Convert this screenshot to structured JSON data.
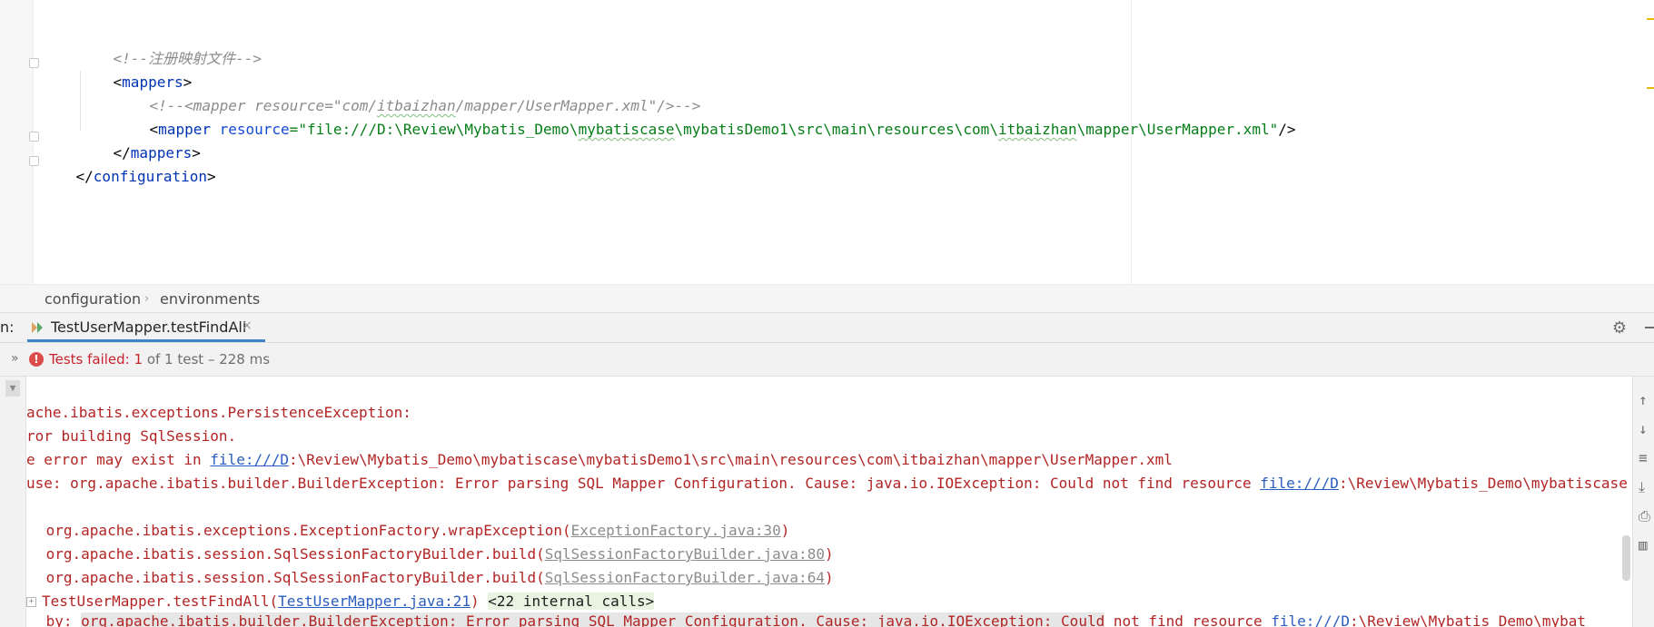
{
  "editor": {
    "lines": [
      {
        "comment": "<!--注册映射文件-->"
      },
      {
        "open": "<",
        "tag": "mappers",
        "close": ">"
      },
      {
        "comment_a": "<!--<mapper resource=\"com/",
        "comment_b": "itbaizhan",
        "comment_c": "/mapper/UserMapper.xml\"/>-->"
      },
      {
        "open": "<",
        "tag": "mapper",
        "attr": " resource",
        "eq": "=",
        "val_a": "\"file:///D:\\Review\\Mybatis_Demo\\",
        "val_b": "mybatiscase",
        "val_c": "\\mybatisDemo1\\src\\main\\resources\\com\\",
        "val_d": "itbaizhan",
        "val_e": "\\mapper\\UserMapper.xml\"",
        "close": "/>"
      },
      {
        "open": "</",
        "tag": "mappers",
        "close": ">"
      },
      {
        "open": "</",
        "tag": "configuration",
        "close": ">"
      }
    ]
  },
  "breadcrumb": {
    "items": [
      "configuration",
      "environments"
    ],
    "separator": "›"
  },
  "run_window": {
    "prefix": "n:",
    "tab_label": "TestUserMapper.testFindAll",
    "tab_close": "×",
    "status_prefix": "Tests failed: ",
    "status_failed_count": "1",
    "status_suffix": " of 1 test – 228 ms"
  },
  "console": {
    "line1": "ache.ibatis.exceptions.PersistenceException: ",
    "line2": "ror building SqlSession.",
    "line3_a": "e error may exist in ",
    "line3_link": "file:///D",
    "line3_b": ":\\Review\\Mybatis_Demo\\mybatiscase\\mybatisDemo1\\src\\main\\resources\\com\\itbaizhan\\mapper\\UserMapper.xml",
    "line4_a": "use: org.apache.ibatis.builder.BuilderException: Error parsing SQL Mapper Configuration. Cause: java.io.IOException: Could not find resource ",
    "line4_link": "file:///D",
    "line4_b": ":\\Review\\Mybatis_Demo\\mybatiscase",
    "stack1_a": " org.apache.ibatis.exceptions.ExceptionFactory.wrapException(",
    "stack1_link": "ExceptionFactory.java:30",
    "stack1_b": ")",
    "stack2_a": " org.apache.ibatis.session.SqlSessionFactoryBuilder.build(",
    "stack2_link": "SqlSessionFactoryBuilder.java:80",
    "stack2_b": ")",
    "stack3_a": " org.apache.ibatis.session.SqlSessionFactoryBuilder.build(",
    "stack3_link": "SqlSessionFactoryBuilder.java:64",
    "stack3_b": ")",
    "stack4_a": "TestUserMapper.testFindAll(",
    "stack4_link": "TestUserMapper.java:21",
    "stack4_b": ") ",
    "stack4_internal": "<22 internal calls>",
    "line_cut_a": " by: ",
    "line_cut_b": "org.apache.ibatis.builder.BuilderException: Error parsing SQL Mapper Configuration. Cause: java.io.IOException: Could",
    "line_cut_c": " not find resource ",
    "line_cut_link": "file:///D",
    "line_cut_d": ":\\Review\\Mybatis_Demo\\mybat"
  }
}
